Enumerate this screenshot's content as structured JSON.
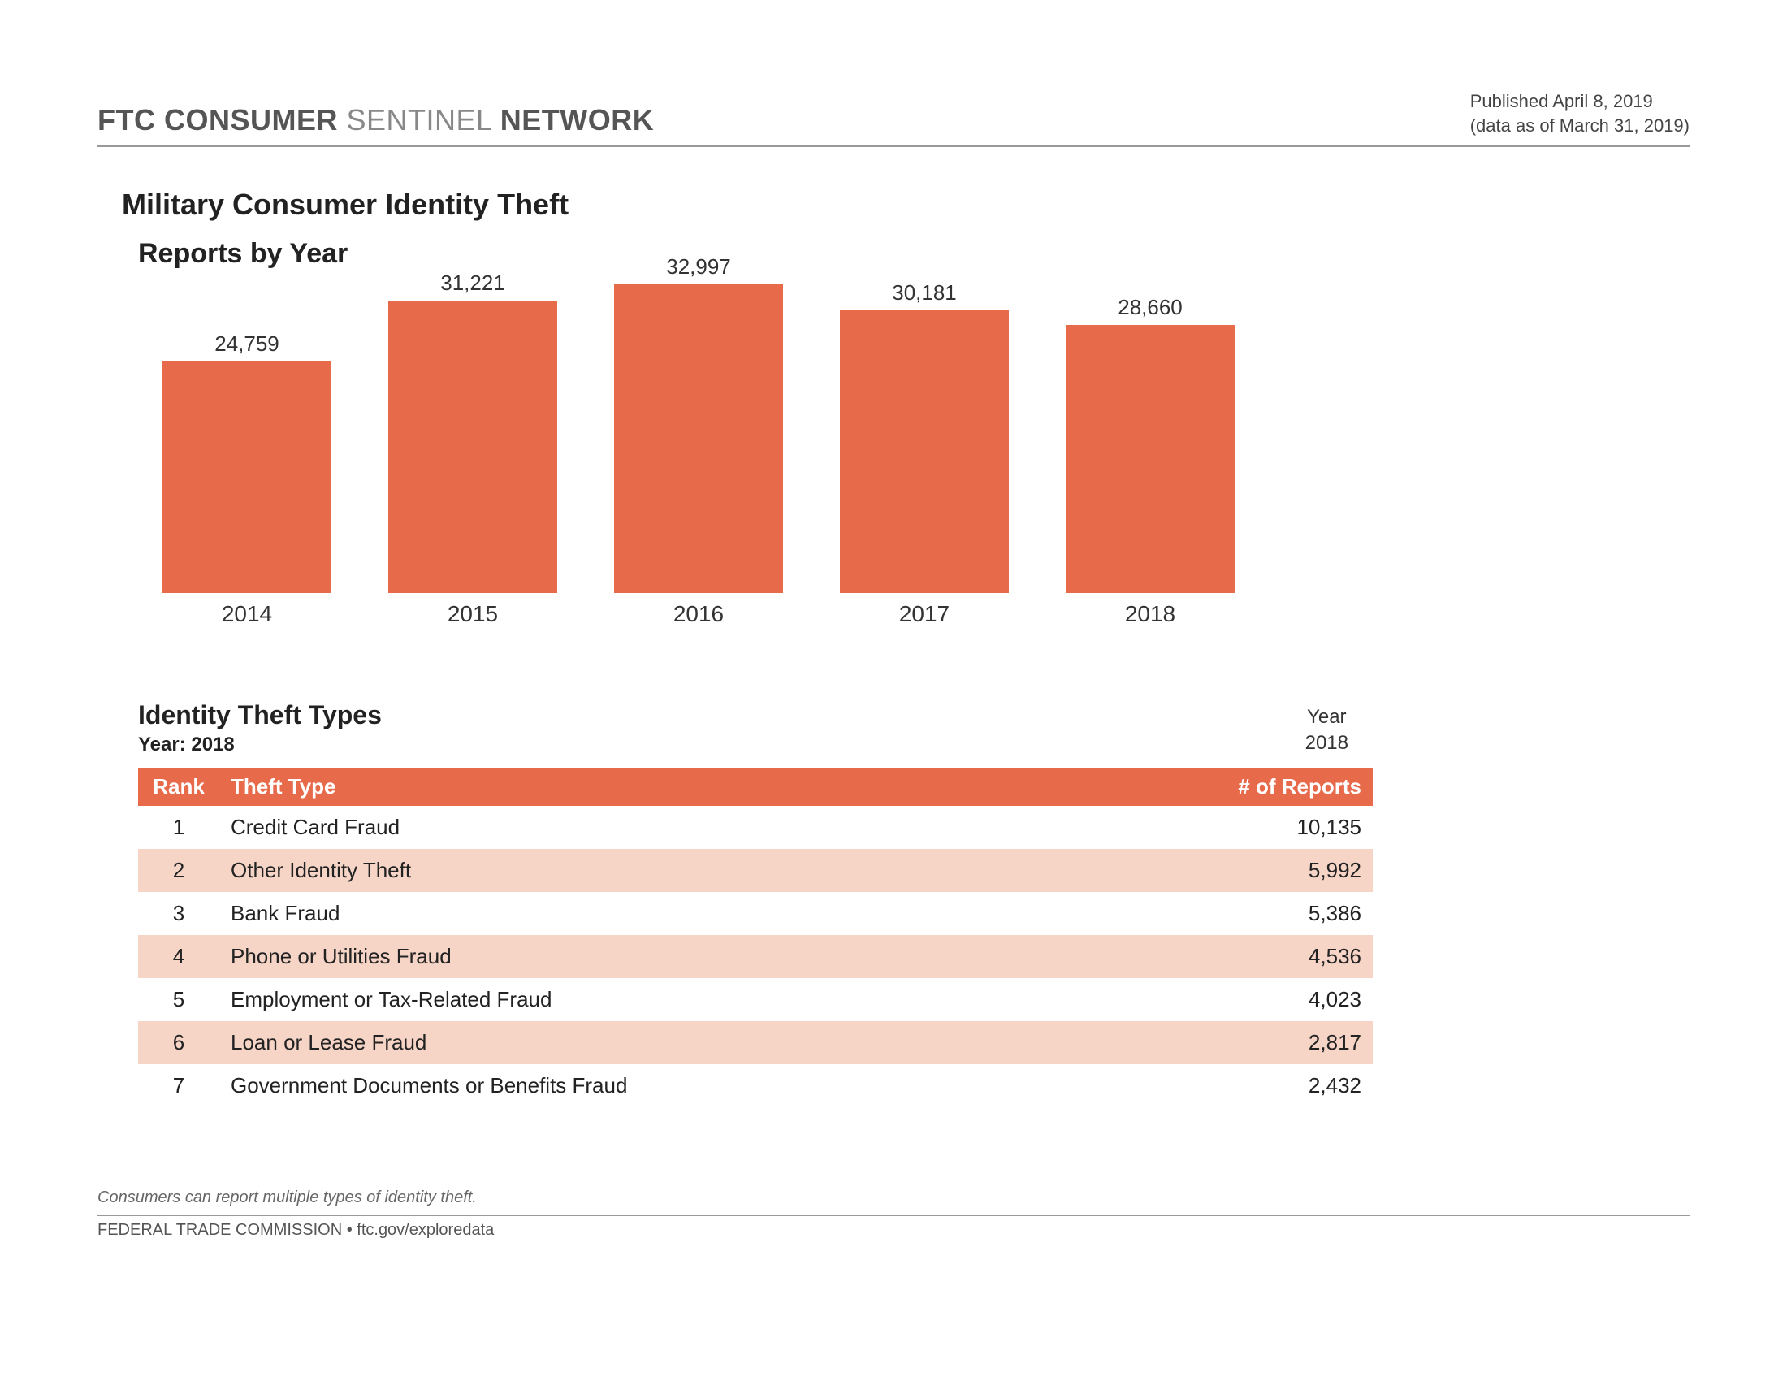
{
  "header": {
    "brand_strong1": "FTC CONSUMER ",
    "brand_light": "SENTINEL ",
    "brand_strong2": "NETWORK",
    "published_line": "Published April 8, 2019",
    "asof_line": "(data as of March 31, 2019)"
  },
  "page_title": "Military Consumer Identity Theft",
  "section_chart_title": "Reports by Year",
  "chart_data": {
    "type": "bar",
    "title": "Reports by Year",
    "categories": [
      "2014",
      "2015",
      "2016",
      "2017",
      "2018"
    ],
    "values": [
      24759,
      31221,
      32997,
      30181,
      28660
    ],
    "value_labels": [
      "24,759",
      "31,221",
      "32,997",
      "30,181",
      "28,660"
    ],
    "xlabel": "",
    "ylabel": "",
    "ylim": [
      0,
      33000
    ]
  },
  "table": {
    "title": "Identity Theft Types",
    "subtitle": "Year: 2018",
    "year_head_line1": "Year",
    "year_head_line2": "2018",
    "columns": {
      "rank": "Rank",
      "type": "Theft Type",
      "reports": "# of Reports"
    },
    "rows": [
      {
        "rank": "1",
        "type": "Credit Card Fraud",
        "reports": "10,135"
      },
      {
        "rank": "2",
        "type": "Other Identity Theft",
        "reports": "5,992"
      },
      {
        "rank": "3",
        "type": "Bank Fraud",
        "reports": "5,386"
      },
      {
        "rank": "4",
        "type": "Phone or Utilities Fraud",
        "reports": "4,536"
      },
      {
        "rank": "5",
        "type": "Employment or Tax-Related Fraud",
        "reports": "4,023"
      },
      {
        "rank": "6",
        "type": "Loan or Lease Fraud",
        "reports": "2,817"
      },
      {
        "rank": "7",
        "type": "Government Documents or Benefits Fraud",
        "reports": "2,432"
      }
    ]
  },
  "footnote": "Consumers can report multiple types of identity theft.",
  "footer": "FEDERAL TRADE COMMISSION • ftc.gov/exploredata"
}
